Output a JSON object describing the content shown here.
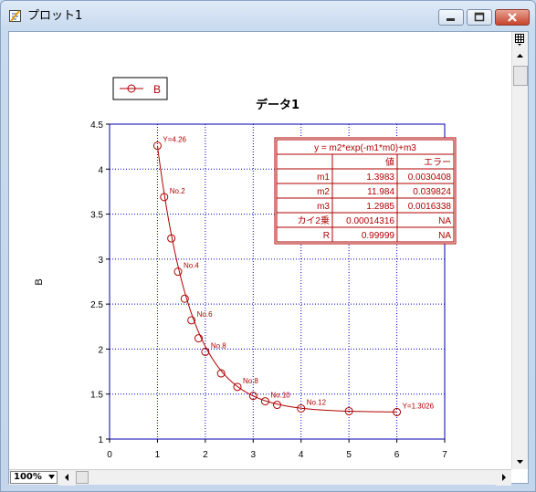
{
  "window": {
    "title": "プロット1"
  },
  "plot": {
    "legend_label": "B",
    "zoom": "100%",
    "fit_table": {
      "equation": "y = m2*exp(-m1*m0)+m3",
      "headers": [
        "",
        "値",
        "エラー"
      ],
      "rows": [
        [
          "m1",
          "1.3983",
          "0.0030408"
        ],
        [
          "m2",
          "11.984",
          "0.039824"
        ],
        [
          "m3",
          "1.2985",
          "0.0016338"
        ],
        [
          "カイ2乗",
          "0.00014316",
          "NA"
        ],
        [
          "R",
          "0.99999",
          "NA"
        ]
      ]
    }
  },
  "chart_data": {
    "type": "scatter",
    "title": "データ1",
    "xlabel": "",
    "ylabel": "B",
    "xlim": [
      0,
      7
    ],
    "ylim": [
      1,
      4.5
    ],
    "x_ticks": [
      "0",
      "1",
      "2",
      "3",
      "4",
      "5",
      "6",
      "7"
    ],
    "y_ticks": [
      "1",
      "1.5",
      "2",
      "2.5",
      "3",
      "3.5",
      "4",
      "4.5"
    ],
    "grid": true,
    "legend_position": "top-left",
    "series": [
      {
        "name": "B",
        "color": "#b00000",
        "x": [
          1.0,
          1.14,
          1.29,
          1.43,
          1.57,
          1.71,
          1.86,
          2.0,
          2.33,
          2.67,
          3.0,
          3.25,
          3.5,
          4.0,
          5.0,
          6.0
        ],
        "y": [
          4.26,
          3.69,
          3.23,
          2.86,
          2.56,
          2.32,
          2.12,
          1.97,
          1.73,
          1.58,
          1.48,
          1.42,
          1.38,
          1.34,
          1.31,
          1.3
        ]
      }
    ],
    "fit_curve": {
      "m1": 1.3983,
      "m2": 11.984,
      "m3": 1.2985
    },
    "annotations": [
      {
        "text": "Y=4.26",
        "x": 1.0,
        "y": 4.26
      },
      {
        "text": "No.2",
        "x": 1.14,
        "y": 3.69
      },
      {
        "text": "No.4",
        "x": 1.43,
        "y": 2.86
      },
      {
        "text": "No.6",
        "x": 1.71,
        "y": 2.32
      },
      {
        "text": "No.8",
        "x": 2.0,
        "y": 1.97
      },
      {
        "text": "No.8",
        "x": 2.67,
        "y": 1.58
      },
      {
        "text": "No.10",
        "x": 3.25,
        "y": 1.42
      },
      {
        "text": "No.12",
        "x": 4.0,
        "y": 1.34
      },
      {
        "text": "Y=1.3026",
        "x": 6.0,
        "y": 1.3
      }
    ]
  }
}
